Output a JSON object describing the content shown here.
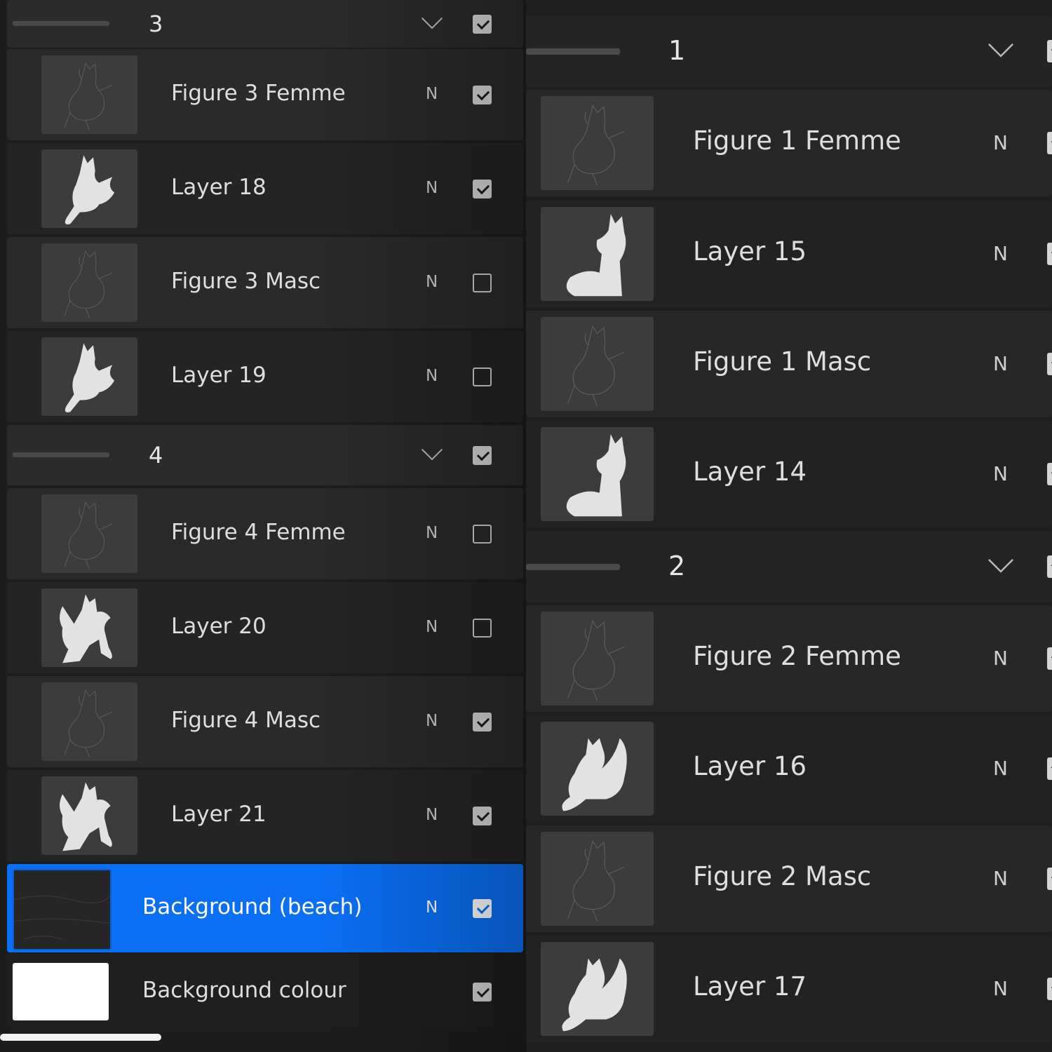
{
  "left_panel": {
    "groups": [
      {
        "label": "3",
        "checked": true
      },
      {
        "label": "4",
        "checked": true
      }
    ],
    "layers": [
      {
        "name": "Figure 3 Femme",
        "blend": "N",
        "checked": true,
        "thumb": "sketch-femme-3"
      },
      {
        "name": "Layer 18",
        "blend": "N",
        "checked": true,
        "thumb": "silhouette-3"
      },
      {
        "name": "Figure 3 Masc",
        "blend": "N",
        "checked": false,
        "thumb": "sketch-masc-3"
      },
      {
        "name": "Layer 19",
        "blend": "N",
        "checked": false,
        "thumb": "silhouette-3"
      },
      {
        "name": "Figure 4 Femme",
        "blend": "N",
        "checked": false,
        "thumb": "sketch-femme-4"
      },
      {
        "name": "Layer 20",
        "blend": "N",
        "checked": false,
        "thumb": "silhouette-4"
      },
      {
        "name": "Figure 4 Masc",
        "blend": "N",
        "checked": true,
        "thumb": "sketch-masc-4"
      },
      {
        "name": "Layer 21",
        "blend": "N",
        "checked": true,
        "thumb": "silhouette-4"
      },
      {
        "name": "Background (beach)",
        "blend": "N",
        "checked": true,
        "selected": true,
        "thumb": "beach"
      },
      {
        "name": "Background colour",
        "checked": true,
        "thumb": "white-fill"
      }
    ]
  },
  "right_panel": {
    "groups": [
      {
        "label": "1"
      },
      {
        "label": "2"
      }
    ],
    "layers": [
      {
        "name": "Figure 1 Femme",
        "blend": "N",
        "thumb": "sketch-femme-1"
      },
      {
        "name": "Layer 15",
        "blend": "N",
        "thumb": "silhouette-1"
      },
      {
        "name": "Figure 1 Masc",
        "blend": "N",
        "thumb": "sketch-masc-1"
      },
      {
        "name": "Layer 14",
        "blend": "N",
        "thumb": "silhouette-1"
      },
      {
        "name": "Figure 2 Femme",
        "blend": "N",
        "thumb": "sketch-femme-2"
      },
      {
        "name": "Layer 16",
        "blend": "N",
        "thumb": "silhouette-2"
      },
      {
        "name": "Figure 2 Masc",
        "blend": "N",
        "thumb": "sketch-masc-2"
      },
      {
        "name": "Layer 17",
        "blend": "N",
        "thumb": "silhouette-2"
      }
    ]
  },
  "colors": {
    "selection": "#0a6ff5",
    "row": "#262626",
    "text": "#e6e6e6"
  },
  "icons": {
    "collapse": "chevron-down-icon",
    "visibility": "checkbox-icon"
  }
}
